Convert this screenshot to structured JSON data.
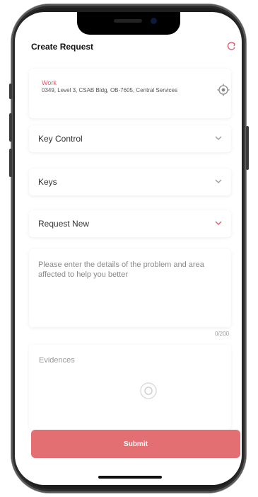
{
  "header": {
    "title": "Create Request"
  },
  "location": {
    "type": "Work",
    "address": "0349, Level 3, CSAB Bldg, OB-7605, Central Services"
  },
  "dropdowns": [
    {
      "label": "Key Control"
    },
    {
      "label": "Keys"
    },
    {
      "label": "Request New"
    }
  ],
  "details": {
    "placeholder": "Please enter the details of the problem and area affected to help you better",
    "counter": "0/200"
  },
  "evidences": {
    "label": "Evidences"
  },
  "submit": {
    "label": "Submit"
  },
  "colors": {
    "accent": "#e05a6a",
    "submit": "#e46f73"
  }
}
